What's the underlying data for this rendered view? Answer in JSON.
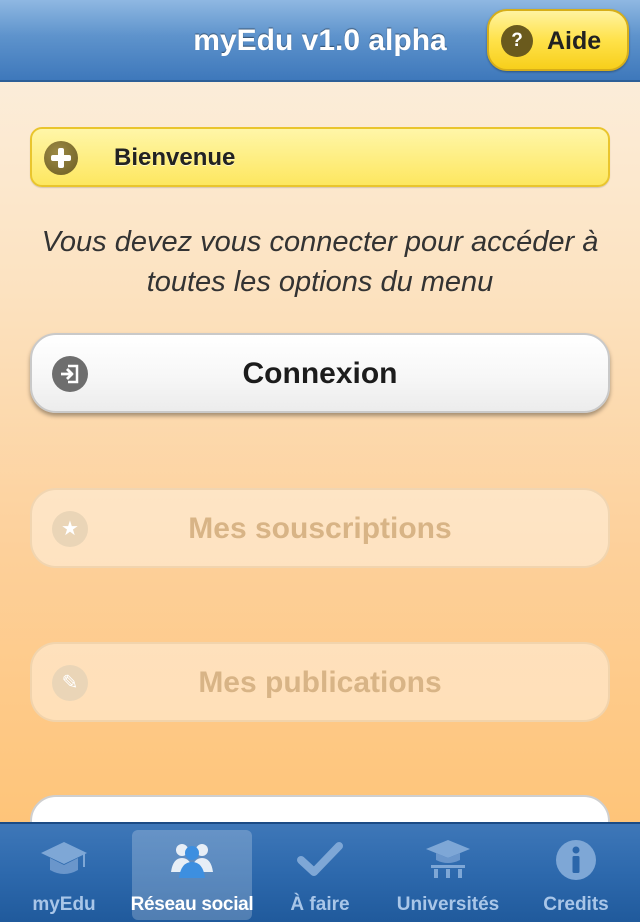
{
  "navbar": {
    "title": "myEdu v1.0 alpha",
    "help_button": {
      "label": "Aide",
      "icon": "question-icon"
    }
  },
  "welcome": {
    "label": "Bienvenue",
    "icon": "plus-circle-icon"
  },
  "notice": "Vous devez vous connecter pour accéder à toutes les options du menu",
  "menu": {
    "login": {
      "label": "Connexion",
      "icon": "login-icon",
      "enabled": true
    },
    "subscriptions": {
      "label": "Mes souscriptions",
      "icon": "star-icon",
      "enabled": false
    },
    "publications": {
      "label": "Mes publications",
      "icon": "pencil-icon",
      "enabled": false
    }
  },
  "tabbar": {
    "tabs": [
      {
        "label": "myEdu",
        "icon": "graduation-cap-icon",
        "selected": false
      },
      {
        "label": "Réseau social",
        "icon": "people-icon",
        "selected": true
      },
      {
        "label": "À faire",
        "icon": "checkmark-icon",
        "selected": false
      },
      {
        "label": "Universités",
        "icon": "university-icon",
        "selected": false
      },
      {
        "label": "Credits",
        "icon": "info-icon",
        "selected": false
      }
    ]
  },
  "colors": {
    "nav_blue": "#4a82c2",
    "highlight_yellow": "#fde760",
    "background_orange": "#ffc06d"
  }
}
